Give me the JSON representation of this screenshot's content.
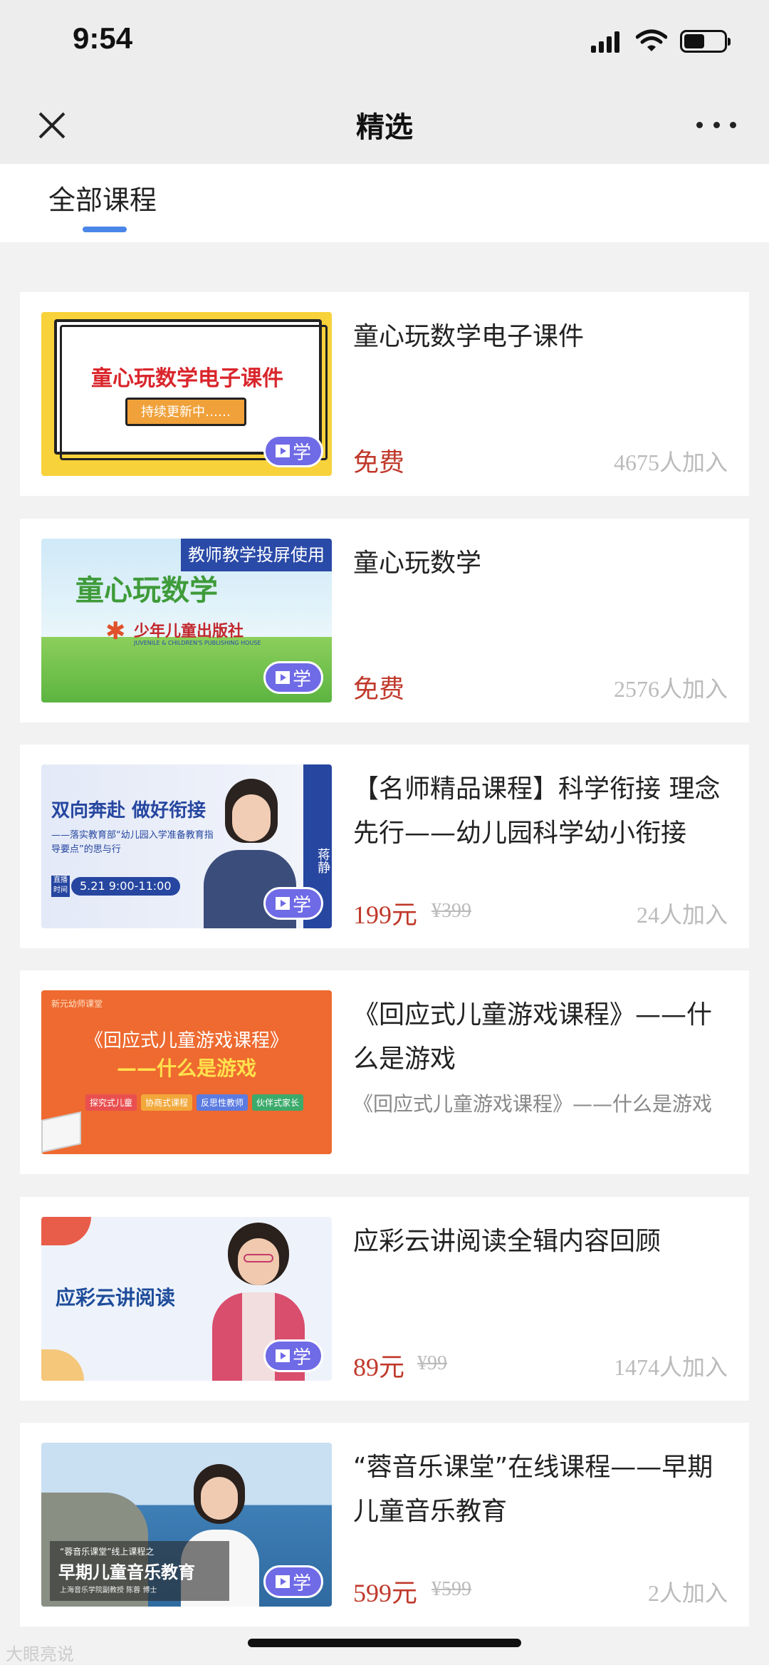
{
  "status_bar": {
    "time": "9:54"
  },
  "nav": {
    "title": "精选"
  },
  "tabs": [
    {
      "label": "全部课程"
    }
  ],
  "courses": [
    {
      "title": "童心玩数学电子课件",
      "price": "免费",
      "join_count": "4675人加入",
      "thumb_title": "童心玩数学电子课件",
      "thumb_sub": "持续更新中……"
    },
    {
      "title": "童心玩数学",
      "price": "免费",
      "join_count": "2576人加入",
      "thumb_tag": "教师教学投屏使用",
      "thumb_title": "童心玩数学",
      "thumb_publisher": "少年儿童出版社",
      "thumb_publisher_en": "JUVENILE & CHILDREN'S PUBLISHING HOUSE"
    },
    {
      "title": "【名师精品课程】科学衔接 理念先行——幼儿园科学幼小衔接",
      "price": "199元",
      "original_price": "¥399",
      "join_count": "24人加入",
      "thumb_title": "双向奔赴 做好衔接",
      "thumb_sub": "——落实教育部“幼儿园入学准备教育指导要点”的思与行",
      "thumb_live": "直播时间",
      "thumb_time": "5.21 9:00-11:00",
      "thumb_name": "蒋静"
    },
    {
      "title": "《回应式儿童游戏课程》——什么是游戏",
      "description": "《回应式儿童游戏课程》——什么是游戏",
      "thumb_brand": "新元幼师课堂",
      "thumb_title": "《回应式儿童游戏课程》",
      "thumb_sub": "——什么是游戏",
      "thumb_tags": [
        "探究式儿童",
        "协商式课程",
        "反思性教师",
        "伙伴式家长"
      ]
    },
    {
      "title": "应彩云讲阅读全辑内容回顾",
      "price": "89元",
      "original_price": "¥99",
      "join_count": "1474人加入",
      "thumb_title": "应彩云讲阅读"
    },
    {
      "title": "“蓉音乐课堂”在线课程——早期儿童音乐教育",
      "price": "599元",
      "original_price": "¥599",
      "join_count": "2人加入",
      "thumb_sub": "“蓉音乐课堂”线上课程之",
      "thumb_title": "早期儿童音乐教育",
      "thumb_author": "上海音乐学院副教授 陈蓉 博士"
    }
  ],
  "badge": {
    "label": "学"
  },
  "watermark": "大眼亮说",
  "colors": {
    "accent": "#4a86e8",
    "price": "#c0392b",
    "badge": "#6f6ae6"
  }
}
